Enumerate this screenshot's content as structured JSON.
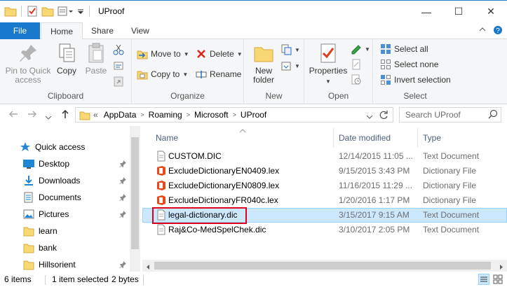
{
  "window": {
    "title": "UProof",
    "minimize_glyph": "—",
    "maximize_glyph": "☐",
    "close_glyph": "✕"
  },
  "ribbon_tabs": {
    "file": "File",
    "home": "Home",
    "share": "Share",
    "view": "View"
  },
  "ribbon": {
    "clipboard": {
      "label": "Clipboard",
      "pin_to_quick_access": "Pin to Quick access",
      "copy": "Copy",
      "paste": "Paste"
    },
    "organize": {
      "label": "Organize",
      "move_to": "Move to",
      "copy_to": "Copy to",
      "delete": "Delete",
      "rename": "Rename"
    },
    "new": {
      "label": "New",
      "new_folder": "New folder"
    },
    "open": {
      "label": "Open",
      "properties": "Properties"
    },
    "select": {
      "label": "Select",
      "select_all": "Select all",
      "select_none": "Select none",
      "invert_selection": "Invert selection"
    }
  },
  "address": {
    "overflow": "«",
    "segments": [
      "AppData",
      "Roaming",
      "Microsoft",
      "UProof"
    ],
    "search_placeholder": "Search UProof"
  },
  "nav": {
    "quick_access": "Quick access",
    "items": [
      {
        "label": "Desktop",
        "icon": "desktop-icon"
      },
      {
        "label": "Downloads",
        "icon": "downloads-icon"
      },
      {
        "label": "Documents",
        "icon": "documents-icon"
      },
      {
        "label": "Pictures",
        "icon": "pictures-icon"
      },
      {
        "label": "learn",
        "icon": "folder-icon"
      },
      {
        "label": "bank",
        "icon": "folder-icon"
      },
      {
        "label": "Hillsorient",
        "icon": "folder-icon"
      }
    ]
  },
  "columns": {
    "name": "Name",
    "date_modified": "Date modified",
    "type": "Type"
  },
  "files": [
    {
      "name": "CUSTOM.DIC",
      "date": "12/14/2015 11:05 ...",
      "type": "Text Document",
      "icon": "text-file-icon"
    },
    {
      "name": "ExcludeDictionaryEN0409.lex",
      "date": "9/15/2015 3:43 PM",
      "type": "Dictionary File",
      "icon": "office-file-icon"
    },
    {
      "name": "ExcludeDictionaryEN0809.lex",
      "date": "11/16/2015 11:29 ...",
      "type": "Dictionary File",
      "icon": "office-file-icon"
    },
    {
      "name": "ExcludeDictionaryFR040c.lex",
      "date": "1/20/2016 1:17 PM",
      "type": "Dictionary File",
      "icon": "office-file-icon"
    },
    {
      "name": "legal-dictionary.dic",
      "date": "3/15/2017 9:15 AM",
      "type": "Text Document",
      "icon": "text-file-icon"
    },
    {
      "name": "Raj&Co-MedSpelChek.dic",
      "date": "3/10/2017 2:05 PM",
      "type": "Text Document",
      "icon": "text-file-icon"
    }
  ],
  "status": {
    "item_count": "6 items",
    "selection": "1 item selected",
    "size": "2 bytes"
  },
  "colors": {
    "accent": "#1979ca",
    "selection_bg": "#cce8ff",
    "highlight_border": "#e0001b",
    "folder": "#f8d775"
  }
}
